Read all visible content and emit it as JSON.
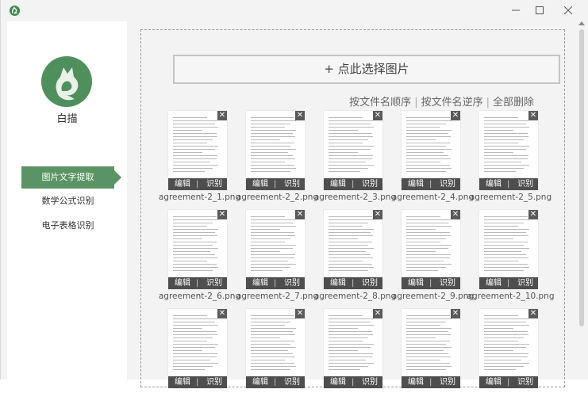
{
  "window": {
    "minimize_symbol": "—",
    "maximize_symbol": "☐",
    "close_symbol": "✕"
  },
  "sidebar": {
    "app_name": "白描",
    "logo_icon": "cat-icon",
    "items": [
      {
        "label": "图片文字提取",
        "active": true
      },
      {
        "label": "数学公式识别",
        "active": false
      },
      {
        "label": "电子表格识别",
        "active": false
      }
    ]
  },
  "main": {
    "select_button_label": "+ 点此选择图片",
    "sort_by_name_asc": "按文件名顺序",
    "sort_by_name_desc": "按文件名逆序",
    "delete_all": "全部删除",
    "separator": "|",
    "thumbnails": [
      {
        "filename": "agreement-2_1.png",
        "edit_label": "编辑",
        "ocr_label": "识别",
        "delete_symbol": "✕"
      },
      {
        "filename": "agreement-2_2.png",
        "edit_label": "编辑",
        "ocr_label": "识别",
        "delete_symbol": "✕"
      },
      {
        "filename": "agreement-2_3.png",
        "edit_label": "编辑",
        "ocr_label": "识别",
        "delete_symbol": "✕"
      },
      {
        "filename": "agreement-2_4.png",
        "edit_label": "编辑",
        "ocr_label": "识别",
        "delete_symbol": "✕"
      },
      {
        "filename": "agreement-2_5.png",
        "edit_label": "编辑",
        "ocr_label": "识别",
        "delete_symbol": "✕"
      },
      {
        "filename": "agreement-2_6.png",
        "edit_label": "编辑",
        "ocr_label": "识别",
        "delete_symbol": "✕"
      },
      {
        "filename": "agreement-2_7.png",
        "edit_label": "编辑",
        "ocr_label": "识别",
        "delete_symbol": "✕"
      },
      {
        "filename": "agreement-2_8.png",
        "edit_label": "编辑",
        "ocr_label": "识别",
        "delete_symbol": "✕"
      },
      {
        "filename": "agreement-2_9.png",
        "edit_label": "编辑",
        "ocr_label": "识别",
        "delete_symbol": "✕"
      },
      {
        "filename": "agreement-2_10.png",
        "edit_label": "编辑",
        "ocr_label": "识别",
        "delete_symbol": "✕"
      },
      {
        "filename": "",
        "edit_label": "编辑",
        "ocr_label": "识别",
        "delete_symbol": "✕"
      },
      {
        "filename": "",
        "edit_label": "编辑",
        "ocr_label": "识别",
        "delete_symbol": "✕"
      },
      {
        "filename": "",
        "edit_label": "编辑",
        "ocr_label": "识别",
        "delete_symbol": "✕"
      },
      {
        "filename": "",
        "edit_label": "编辑",
        "ocr_label": "识别",
        "delete_symbol": "✕"
      },
      {
        "filename": "",
        "edit_label": "编辑",
        "ocr_label": "识别",
        "delete_symbol": "✕"
      }
    ]
  },
  "colors": {
    "accent": "#5a9464",
    "logo": "#4f8f5b",
    "background": "#f3f3f3"
  }
}
